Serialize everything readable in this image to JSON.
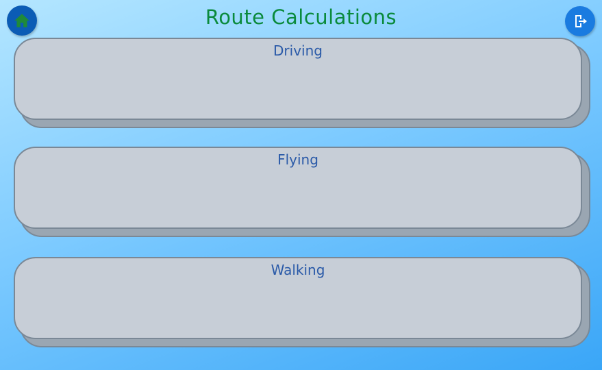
{
  "header": {
    "title": "Route Calculations",
    "home_icon": "home-icon",
    "logout_icon": "logout-icon"
  },
  "cards": [
    {
      "label": "Driving"
    },
    {
      "label": "Flying"
    },
    {
      "label": "Walking"
    }
  ],
  "colors": {
    "title": "#0a8a3c",
    "home_button": "#0b5cb5",
    "home_icon": "#1f8a3a",
    "logout_button": "#1a7be0",
    "card_fill": "#c7ced7",
    "card_text": "#2a5aa8"
  }
}
